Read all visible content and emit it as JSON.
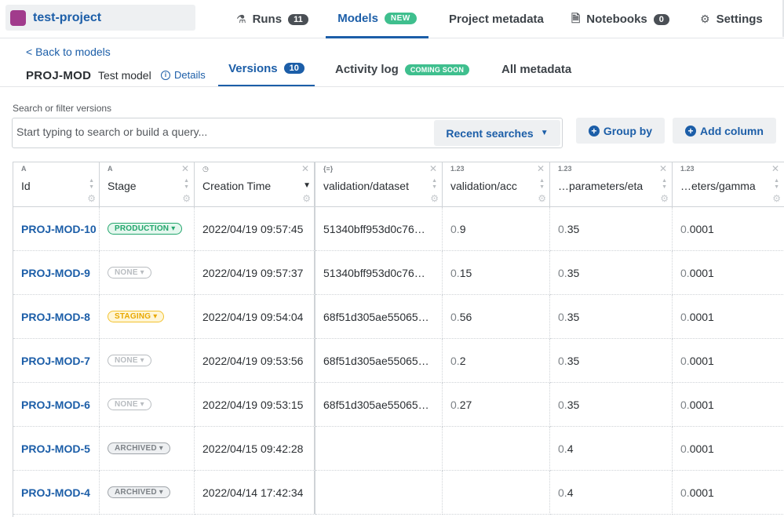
{
  "project": {
    "name": "test-project",
    "color": "#a13b8c"
  },
  "nav": {
    "runs": {
      "label": "Runs",
      "count": "11"
    },
    "models": {
      "label": "Models",
      "badge": "NEW"
    },
    "metadata": {
      "label": "Project metadata"
    },
    "notebooks": {
      "label": "Notebooks",
      "count": "0"
    },
    "settings": {
      "label": "Settings"
    }
  },
  "model": {
    "back_label": "< Back to models",
    "id": "PROJ-MOD",
    "name": "Test model",
    "details_label": "Details"
  },
  "subtabs": {
    "versions": {
      "label": "Versions",
      "count": "10"
    },
    "activity": {
      "label": "Activity log",
      "badge": "COMING SOON"
    },
    "all_metadata": {
      "label": "All metadata"
    }
  },
  "search": {
    "label": "Search or filter versions",
    "placeholder": "Start typing to search or build a query...",
    "recent_label": "Recent searches"
  },
  "toolbar": {
    "group_by": "Group by",
    "add_column": "Add column"
  },
  "columns": [
    {
      "type": "A",
      "title": "Id"
    },
    {
      "type": "A",
      "title": "Stage"
    },
    {
      "type": "◷",
      "title": "Creation Time"
    },
    {
      "type": "{≡}",
      "title": "validation/dataset"
    },
    {
      "type": "1.23",
      "title": "validation/acc"
    },
    {
      "type": "1.23",
      "title": "…parameters/eta"
    },
    {
      "type": "1.23",
      "title": "…eters/gamma"
    }
  ],
  "rows": [
    {
      "id": "PROJ-MOD-10",
      "stage": "PRODUCTION",
      "stage_kind": "production",
      "time": "2022/04/19 09:57:45",
      "dataset": "51340bff953d0c76…",
      "acc_int": "0.",
      "acc_dec": "9",
      "eta_int": "0.",
      "eta_dec": "35",
      "gamma_int": "0.",
      "gamma_dec": "0001"
    },
    {
      "id": "PROJ-MOD-9",
      "stage": "NONE",
      "stage_kind": "none",
      "time": "2022/04/19 09:57:37",
      "dataset": "51340bff953d0c76…",
      "acc_int": "0.",
      "acc_dec": "15",
      "eta_int": "0.",
      "eta_dec": "35",
      "gamma_int": "0.",
      "gamma_dec": "0001"
    },
    {
      "id": "PROJ-MOD-8",
      "stage": "STAGING",
      "stage_kind": "staging",
      "time": "2022/04/19 09:54:04",
      "dataset": "68f51d305ae55065…",
      "acc_int": "0.",
      "acc_dec": "56",
      "eta_int": "0.",
      "eta_dec": "35",
      "gamma_int": "0.",
      "gamma_dec": "0001"
    },
    {
      "id": "PROJ-MOD-7",
      "stage": "NONE",
      "stage_kind": "none",
      "time": "2022/04/19 09:53:56",
      "dataset": "68f51d305ae55065…",
      "acc_int": "0.",
      "acc_dec": "2",
      "eta_int": "0.",
      "eta_dec": "35",
      "gamma_int": "0.",
      "gamma_dec": "0001"
    },
    {
      "id": "PROJ-MOD-6",
      "stage": "NONE",
      "stage_kind": "none",
      "time": "2022/04/19 09:53:15",
      "dataset": "68f51d305ae55065…",
      "acc_int": "0.",
      "acc_dec": "27",
      "eta_int": "0.",
      "eta_dec": "35",
      "gamma_int": "0.",
      "gamma_dec": "0001"
    },
    {
      "id": "PROJ-MOD-5",
      "stage": "ARCHIVED",
      "stage_kind": "archived",
      "time": "2022/04/15 09:42:28",
      "dataset": "",
      "acc_int": "",
      "acc_dec": "",
      "eta_int": "0.",
      "eta_dec": "4",
      "gamma_int": "0.",
      "gamma_dec": "0001"
    },
    {
      "id": "PROJ-MOD-4",
      "stage": "ARCHIVED",
      "stage_kind": "archived",
      "time": "2022/04/14 17:42:34",
      "dataset": "",
      "acc_int": "",
      "acc_dec": "",
      "eta_int": "0.",
      "eta_dec": "4",
      "gamma_int": "0.",
      "gamma_dec": "0001"
    }
  ]
}
